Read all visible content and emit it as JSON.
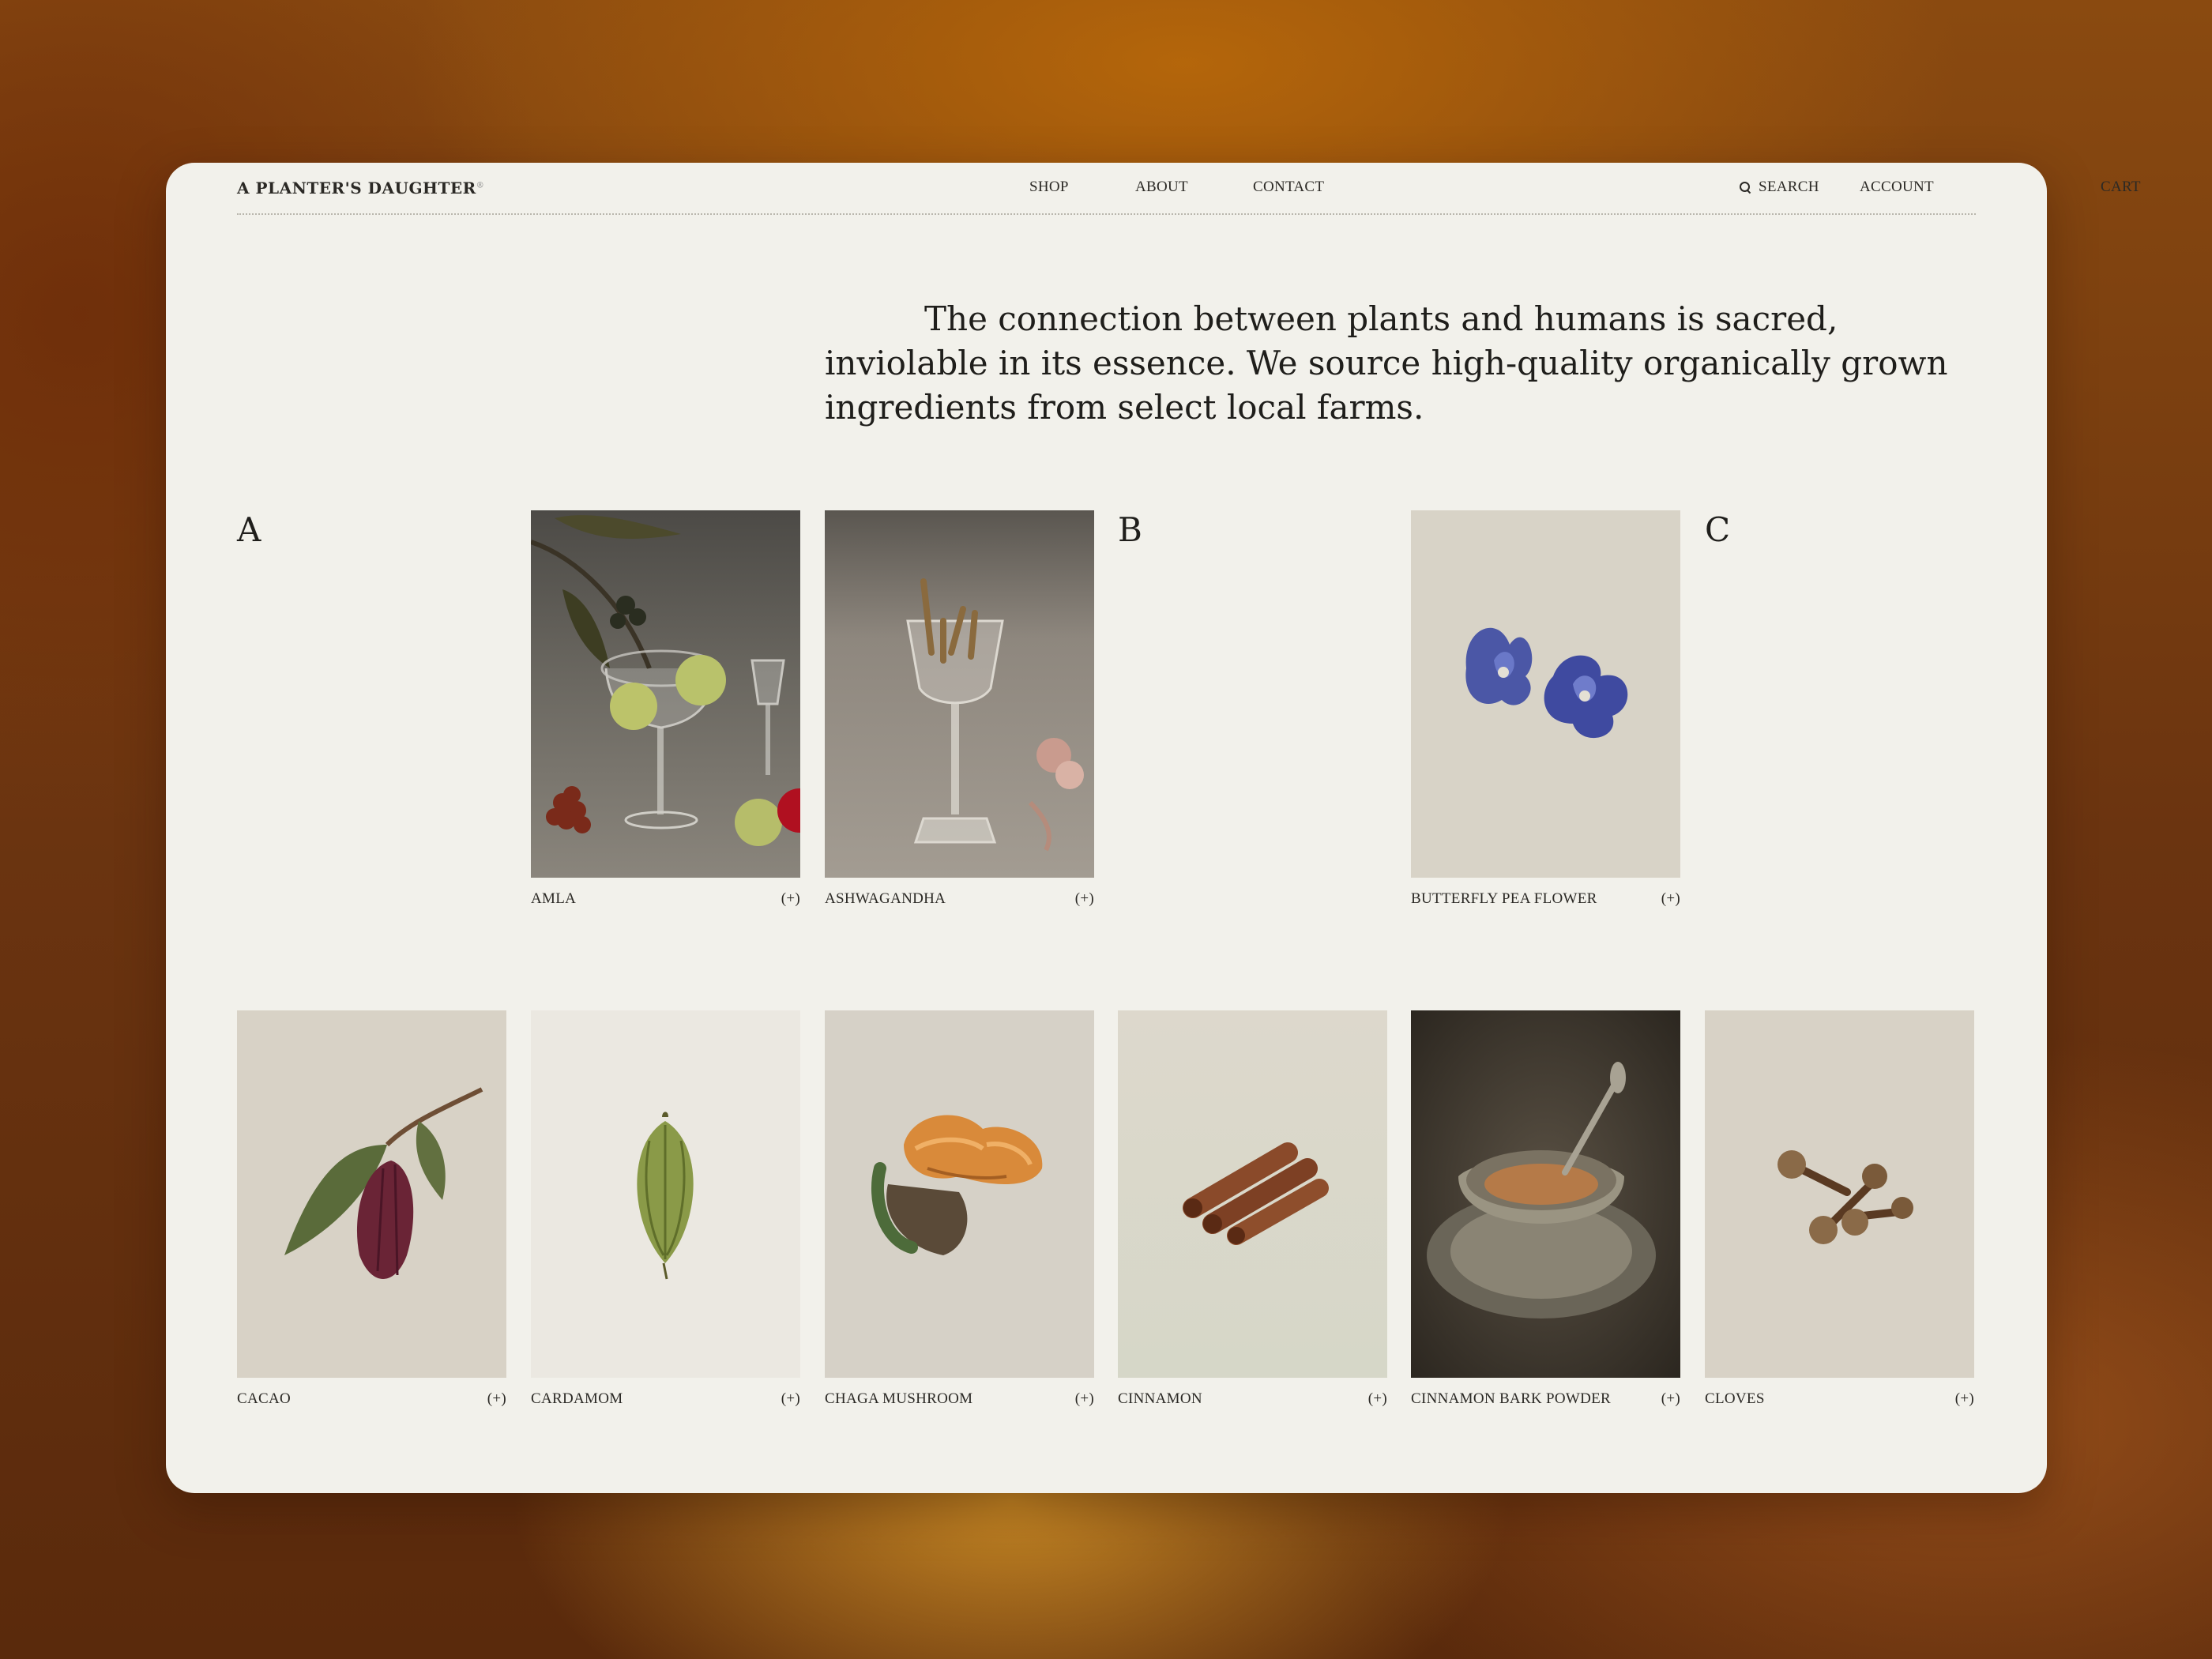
{
  "nav": {
    "brand": "A PLANTER'S DAUGHTER",
    "brand_mark": "®",
    "links": {
      "shop": "SHOP",
      "about": "ABOUT",
      "contact": "CONTACT"
    },
    "search": "SEARCH",
    "account": "ACCOUNT",
    "cart": "CART"
  },
  "intro": "The connection between plants and humans is sacred, inviolable in its essence. We source high-quality organically grown ingredients from select local farms.",
  "letters": {
    "a": "A",
    "b": "B",
    "c": "C"
  },
  "products": [
    {
      "name": "AMLA",
      "action": "(+)"
    },
    {
      "name": "ASHWAGANDHA",
      "action": "(+)"
    },
    {
      "name": "BUTTERFLY PEA FLOWER",
      "action": "(+)"
    },
    {
      "name": "CACAO",
      "action": "(+)"
    },
    {
      "name": "CARDAMOM",
      "action": "(+)"
    },
    {
      "name": "CHAGA MUSHROOM",
      "action": "(+)"
    },
    {
      "name": "CINNAMON",
      "action": "(+)"
    },
    {
      "name": "CINNAMON BARK POWDER",
      "action": "(+)"
    },
    {
      "name": "CLOVES",
      "action": "(+)"
    }
  ],
  "colors": {
    "page_bg": "#f2f1eb",
    "text": "#1f1e1b",
    "backdrop": "#7a3c10"
  }
}
